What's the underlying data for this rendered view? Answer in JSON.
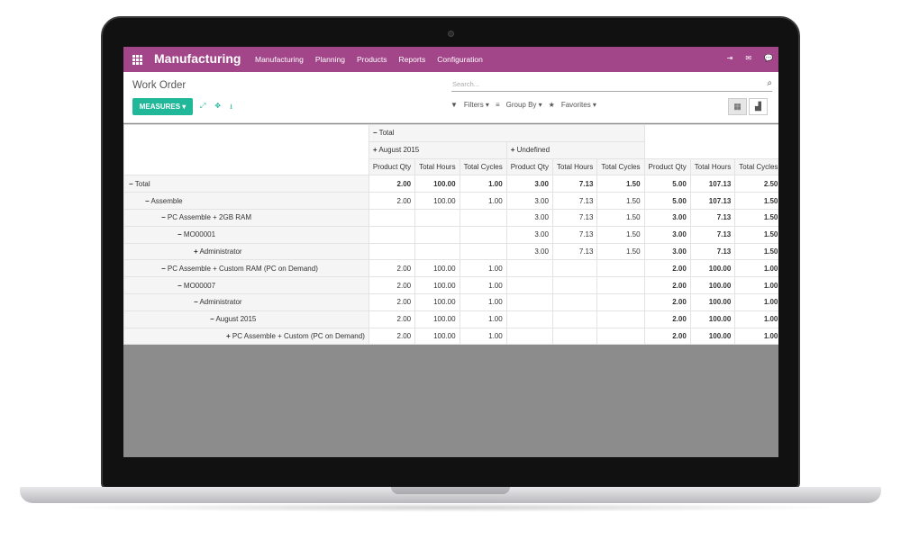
{
  "app": {
    "name": "Manufacturing",
    "menu": [
      "Manufacturing",
      "Planning",
      "Products",
      "Reports",
      "Configuration"
    ]
  },
  "control": {
    "title": "Work Order",
    "search_placeholder": "Search...",
    "measures_label": "MEASURES ▾",
    "filters_label": "Filters ▾",
    "groupby_label": "Group By ▾",
    "favorites_label": "Favorites ▾"
  },
  "pivot": {
    "col_total": "Total",
    "col_groups": [
      "August 2015",
      "Undefined"
    ],
    "measures": [
      "Product Qty",
      "Total Hours",
      "Total Cycles"
    ],
    "rows": [
      {
        "label": "Total",
        "sign": "−",
        "indent": 0,
        "bold": true,
        "aug": [
          "2.00",
          "100.00",
          "1.00"
        ],
        "und": [
          "3.00",
          "7.13",
          "1.50"
        ],
        "tot": [
          "5.00",
          "107.13",
          "2.50"
        ]
      },
      {
        "label": "Assemble",
        "sign": "−",
        "indent": 1,
        "bold": false,
        "aug": [
          "2.00",
          "100.00",
          "1.00"
        ],
        "und": [
          "3.00",
          "7.13",
          "1.50"
        ],
        "tot": [
          "5.00",
          "107.13",
          "1.50"
        ]
      },
      {
        "label": "PC Assemble + 2GB RAM",
        "sign": "−",
        "indent": 2,
        "bold": false,
        "aug": [
          "",
          "",
          ""
        ],
        "und": [
          "3.00",
          "7.13",
          "1.50"
        ],
        "tot": [
          "3.00",
          "7.13",
          "1.50"
        ]
      },
      {
        "label": "MO00001",
        "sign": "−",
        "indent": 3,
        "bold": false,
        "aug": [
          "",
          "",
          ""
        ],
        "und": [
          "3.00",
          "7.13",
          "1.50"
        ],
        "tot": [
          "3.00",
          "7.13",
          "1.50"
        ]
      },
      {
        "label": "Administrator",
        "sign": "+",
        "indent": 4,
        "bold": false,
        "aug": [
          "",
          "",
          ""
        ],
        "und": [
          "3.00",
          "7.13",
          "1.50"
        ],
        "tot": [
          "3.00",
          "7.13",
          "1.50"
        ]
      },
      {
        "label": "PC Assemble + Custom RAM (PC on Demand)",
        "sign": "−",
        "indent": 2,
        "bold": false,
        "aug": [
          "2.00",
          "100.00",
          "1.00"
        ],
        "und": [
          "",
          "",
          ""
        ],
        "tot": [
          "2.00",
          "100.00",
          "1.00"
        ]
      },
      {
        "label": "MO00007",
        "sign": "−",
        "indent": 3,
        "bold": false,
        "aug": [
          "2.00",
          "100.00",
          "1.00"
        ],
        "und": [
          "",
          "",
          ""
        ],
        "tot": [
          "2.00",
          "100.00",
          "1.00"
        ]
      },
      {
        "label": "Administrator",
        "sign": "−",
        "indent": 4,
        "bold": false,
        "aug": [
          "2.00",
          "100.00",
          "1.00"
        ],
        "und": [
          "",
          "",
          ""
        ],
        "tot": [
          "2.00",
          "100.00",
          "1.00"
        ]
      },
      {
        "label": "August 2015",
        "sign": "−",
        "indent": 5,
        "bold": false,
        "aug": [
          "2.00",
          "100.00",
          "1.00"
        ],
        "und": [
          "",
          "",
          ""
        ],
        "tot": [
          "2.00",
          "100.00",
          "1.00"
        ]
      },
      {
        "label": "PC Assemble + Custom (PC on Demand)",
        "sign": "+",
        "indent": 6,
        "bold": false,
        "aug": [
          "2.00",
          "100.00",
          "1.00"
        ],
        "und": [
          "",
          "",
          ""
        ],
        "tot": [
          "2.00",
          "100.00",
          "1.00"
        ]
      }
    ]
  }
}
